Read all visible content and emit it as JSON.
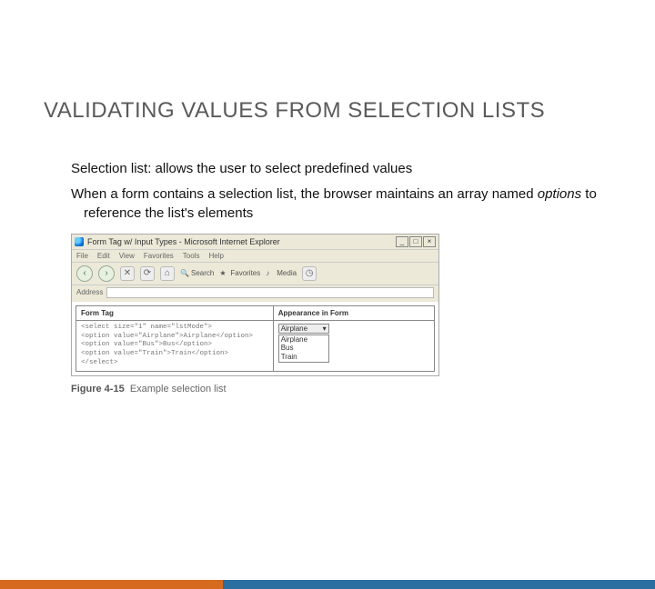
{
  "title": "VALIDATING VALUES FROM SELECTION LISTS",
  "paragraphs": {
    "p1": "Selection list: allows the user to select predefined values",
    "p2_a": "When a form contains a selection list, the browser maintains an array named ",
    "p2_em": "options",
    "p2_b": " to reference the list's elements"
  },
  "browser": {
    "title": "Form Tag w/ Input Types - Microsoft Internet Explorer",
    "menu": [
      "File",
      "Edit",
      "View",
      "Favorites",
      "Tools",
      "Help"
    ],
    "toolbar": {
      "back": "‹",
      "fwd": "›",
      "search": "Search",
      "favorites": "Favorites",
      "media": "Media"
    },
    "address_label": "Address",
    "table": {
      "headers": [
        "Form Tag",
        "Appearance in Form"
      ],
      "code_lines": [
        "<select size=\"1\" name=\"lstMode\">",
        "  <option value=\"Airplane\">Airplane</option>",
        "  <option value=\"Bus\">Bus</option>",
        "  <option value=\"Train\">Train</option>",
        "</select>"
      ],
      "select_top": "Airplane",
      "select_items": [
        "Airplane",
        "Bus",
        "Train"
      ]
    }
  },
  "caption_label": "Figure 4-15",
  "caption_text": "Example selection list"
}
